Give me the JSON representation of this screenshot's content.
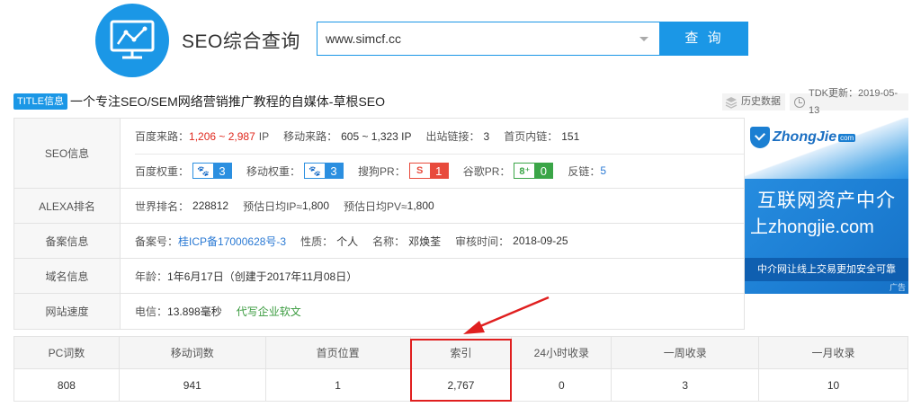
{
  "header": {
    "brand_title": "SEO综合查询",
    "search_value": "www.simcf.cc",
    "search_button": "查 询"
  },
  "titlebar": {
    "tag": "TITLE信息",
    "text": "一个专注SEO/SEM网络营销推广教程的自媒体-草根SEO",
    "history": "历史数据",
    "tdk": "TDK更新：2019-05-13"
  },
  "info": {
    "seo": {
      "label": "SEO信息",
      "baidu_source_label": "百度来路：",
      "baidu_source_value": "1,206 ~ 2,987",
      "baidu_source_unit": "IP",
      "mobile_source_label": "移动来路：",
      "mobile_source_value": "605 ~ 1,323 IP",
      "outlinks_label": "出站链接：",
      "outlinks_value": "3",
      "homepage_links_label": "首页内链：",
      "homepage_links_value": "151",
      "baidu_weight_label": "百度权重：",
      "baidu_weight_value": "3",
      "mobile_weight_label": "移动权重：",
      "mobile_weight_value": "3",
      "sogou_pr_label": "搜狗PR：",
      "sogou_pr_icon": "S",
      "sogou_pr_value": "1",
      "google_pr_label": "谷歌PR：",
      "google_pr_icon": "8⁺",
      "google_pr_value": "0",
      "backlinks_label": "反链：",
      "backlinks_value": "5"
    },
    "alexa": {
      "label": "ALEXA排名",
      "world_rank_label": "世界排名：",
      "world_rank_value": "228812",
      "est_ip_label": "预估日均IP≈",
      "est_ip_value": "1,800",
      "est_pv_label": "预估日均PV≈",
      "est_pv_value": "1,800"
    },
    "icp": {
      "label": "备案信息",
      "icp_label": "备案号：",
      "icp_value": "桂ICP备17000628号-3",
      "nature_label": "性质：",
      "nature_value": "个人",
      "name_label": "名称：",
      "name_value": "邓焕荃",
      "audit_label": "审核时间：",
      "audit_value": "2018-09-25"
    },
    "domain": {
      "label": "域名信息",
      "age_label": "年龄：",
      "age_value": "1年6月17日（创建于2017年11月08日）"
    },
    "speed": {
      "label": "网站速度",
      "telecom_label": "电信：",
      "telecom_value": "13.898毫秒",
      "link_text": "代写企业软文"
    }
  },
  "ad": {
    "logo": "ZhongJie",
    "logo_sub": "com",
    "line1": "互联网资产中介",
    "line2": "上zhongjie.com",
    "strip": "中介网让线上交易更加安全可靠",
    "mark": "广告"
  },
  "stats": {
    "headers": [
      "PC词数",
      "移动词数",
      "首页位置",
      "索引",
      "24小时收录",
      "一周收录",
      "一月收录"
    ],
    "values": [
      "808",
      "941",
      "1",
      "2,767",
      "0",
      "3",
      "10"
    ]
  },
  "colors": {
    "accent": "#1b97e6",
    "highlight": "#e01f1f"
  }
}
